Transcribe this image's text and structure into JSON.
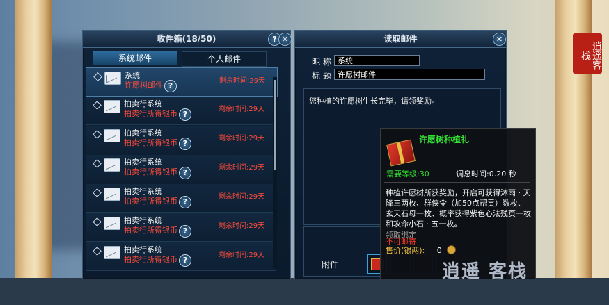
{
  "inbox": {
    "title": "收件箱(18/50)",
    "help_btn": "?",
    "close_btn": "✕",
    "tabs": [
      {
        "label": "系统邮件",
        "active": true
      },
      {
        "label": "个人邮件",
        "active": false
      }
    ],
    "items": [
      {
        "sender": "系统",
        "subject": "许愿树邮件",
        "remain": "剩余时间:29天",
        "selected": true
      },
      {
        "sender": "拍卖行系统",
        "subject": "拍卖行所得银币",
        "remain": "剩余时间:29天"
      },
      {
        "sender": "拍卖行系统",
        "subject": "拍卖行所得银币",
        "remain": "剩余时间:29天"
      },
      {
        "sender": "拍卖行系统",
        "subject": "拍卖行所得银币",
        "remain": "剩余时间:29天"
      },
      {
        "sender": "拍卖行系统",
        "subject": "拍卖行所得银币",
        "remain": "剩余时间:29天"
      },
      {
        "sender": "拍卖行系统",
        "subject": "拍卖行所得银币",
        "remain": "剩余时间:29天"
      },
      {
        "sender": "拍卖行系统",
        "subject": "拍卖行所得银币",
        "remain": "剩余时间:29天"
      }
    ],
    "item_help": "?"
  },
  "reader": {
    "title": "读取邮件",
    "close_btn": "✕",
    "nickname_label": "昵 称",
    "nickname_value": "系统",
    "subject_label": "标 题",
    "subject_value": "许愿树邮件",
    "body": "您种植的许愿树生长完毕，请领奖励。",
    "attachments_label": "附件"
  },
  "tooltip": {
    "item_name": "许愿树种植礼",
    "req_level": "需要等级:30",
    "cooldown": "调息时间:0.20 秒",
    "description": "种植许愿树所获奖励，开启可获得沐雨 · 天降三两枚、群侠令（加50点帮贡）数枚、玄天石母一枚、概率获得紫色心法残页一枚和攻命小石 · 五一枚。",
    "bind_label": "领取绑定",
    "no_mail": "不可邮寄",
    "price_label": "售价(银两):",
    "price_value": "0"
  },
  "branding": {
    "seal_text": "逍遥客栈",
    "watermark": "逍遥 客栈"
  },
  "colors": {
    "green_title": "#33e033",
    "red_text": "#ff4a3a",
    "gold": "#f0c040"
  }
}
